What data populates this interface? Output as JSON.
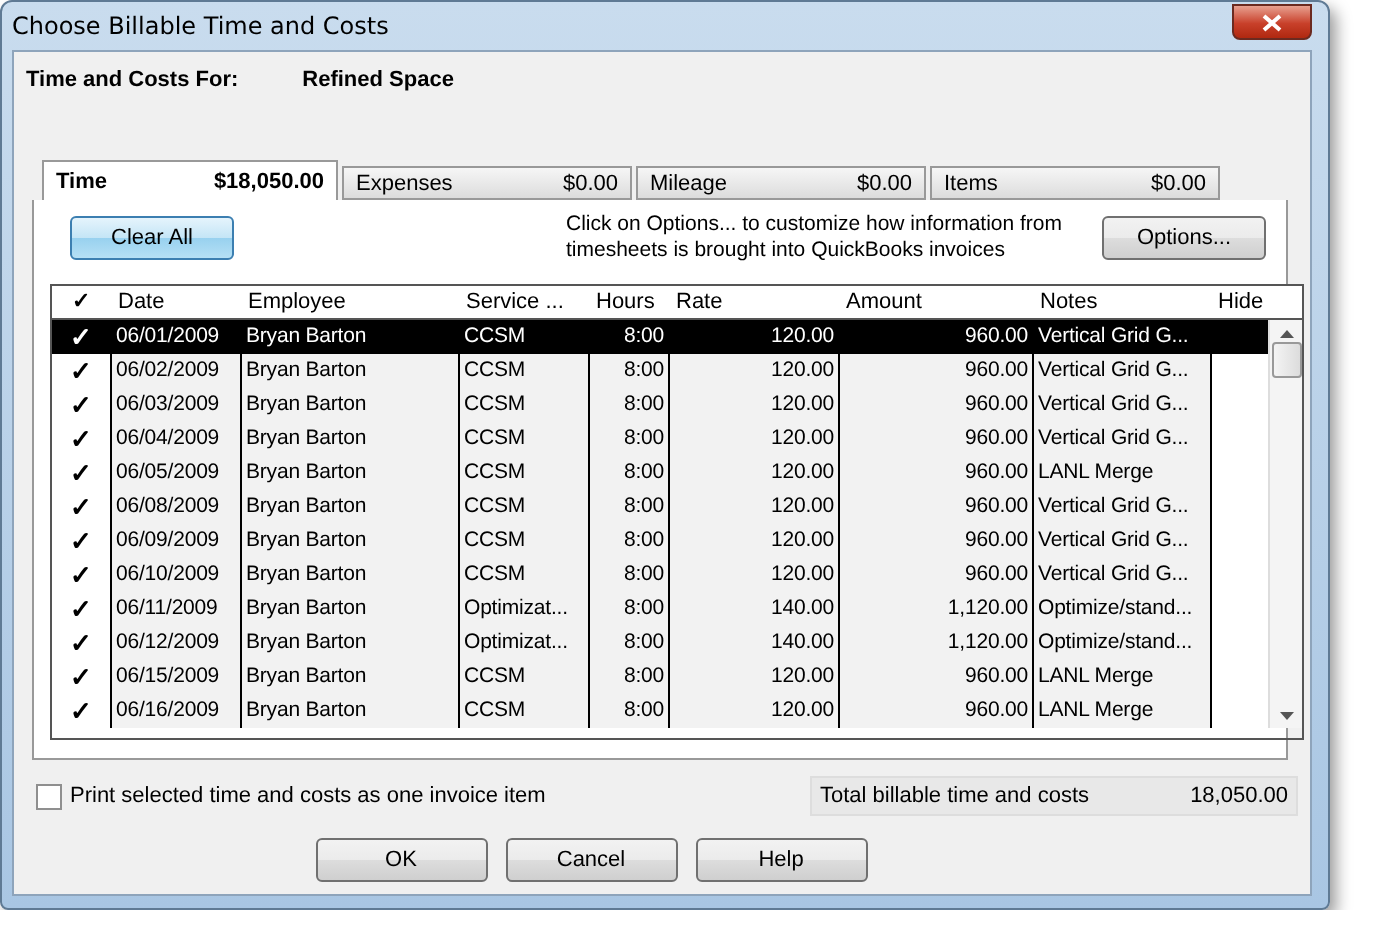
{
  "window": {
    "title": "Choose Billable Time and Costs"
  },
  "header": {
    "label": "Time and Costs For:",
    "customer": "Refined Space"
  },
  "tabs": [
    {
      "label": "Time",
      "amount": "$18,050.00",
      "selected": true
    },
    {
      "label": "Expenses",
      "amount": "$0.00",
      "selected": false
    },
    {
      "label": "Mileage",
      "amount": "$0.00",
      "selected": false
    },
    {
      "label": "Items",
      "amount": "$0.00",
      "selected": false
    }
  ],
  "clear_button": "Clear All",
  "options_hint": "Click on Options... to customize how information from timesheets is brought into QuickBooks invoices",
  "options_button": "Options...",
  "table": {
    "check_header": "✓",
    "columns": [
      "Date",
      "Employee",
      "Service ...",
      "Hours",
      "Rate",
      "Amount",
      "Notes",
      "Hide"
    ],
    "rows": [
      {
        "checked": true,
        "selected": true,
        "cells": [
          "06/01/2009",
          "Bryan Barton",
          "CCSM",
          "8:00",
          "120.00",
          "960.00",
          "Vertical Grid G..."
        ]
      },
      {
        "checked": true,
        "selected": false,
        "cells": [
          "06/02/2009",
          "Bryan Barton",
          "CCSM",
          "8:00",
          "120.00",
          "960.00",
          "Vertical Grid G..."
        ]
      },
      {
        "checked": true,
        "selected": false,
        "cells": [
          "06/03/2009",
          "Bryan Barton",
          "CCSM",
          "8:00",
          "120.00",
          "960.00",
          "Vertical Grid G..."
        ]
      },
      {
        "checked": true,
        "selected": false,
        "cells": [
          "06/04/2009",
          "Bryan Barton",
          "CCSM",
          "8:00",
          "120.00",
          "960.00",
          "Vertical Grid G..."
        ]
      },
      {
        "checked": true,
        "selected": false,
        "cells": [
          "06/05/2009",
          "Bryan Barton",
          "CCSM",
          "8:00",
          "120.00",
          "960.00",
          "LANL Merge"
        ]
      },
      {
        "checked": true,
        "selected": false,
        "cells": [
          "06/08/2009",
          "Bryan Barton",
          "CCSM",
          "8:00",
          "120.00",
          "960.00",
          "Vertical Grid G..."
        ]
      },
      {
        "checked": true,
        "selected": false,
        "cells": [
          "06/09/2009",
          "Bryan Barton",
          "CCSM",
          "8:00",
          "120.00",
          "960.00",
          "Vertical Grid G..."
        ]
      },
      {
        "checked": true,
        "selected": false,
        "cells": [
          "06/10/2009",
          "Bryan Barton",
          "CCSM",
          "8:00",
          "120.00",
          "960.00",
          "Vertical Grid G..."
        ]
      },
      {
        "checked": true,
        "selected": false,
        "cells": [
          "06/11/2009",
          "Bryan Barton",
          "Optimizat...",
          "8:00",
          "140.00",
          "1,120.00",
          "Optimize/stand..."
        ]
      },
      {
        "checked": true,
        "selected": false,
        "cells": [
          "06/12/2009",
          "Bryan Barton",
          "Optimizat...",
          "8:00",
          "140.00",
          "1,120.00",
          "Optimize/stand..."
        ]
      },
      {
        "checked": true,
        "selected": false,
        "cells": [
          "06/15/2009",
          "Bryan Barton",
          "CCSM",
          "8:00",
          "120.00",
          "960.00",
          "LANL Merge"
        ]
      },
      {
        "checked": true,
        "selected": false,
        "cells": [
          "06/16/2009",
          "Bryan Barton",
          "CCSM",
          "8:00",
          "120.00",
          "960.00",
          "LANL Merge"
        ]
      }
    ]
  },
  "print_option": {
    "label": "Print selected time and costs as one invoice item",
    "checked": false
  },
  "total": {
    "label": "Total billable time and costs",
    "value": "18,050.00"
  },
  "buttons": [
    "OK",
    "Cancel",
    "Help"
  ]
}
